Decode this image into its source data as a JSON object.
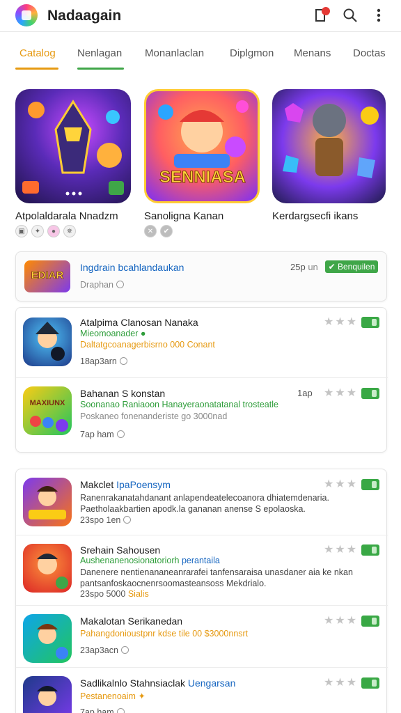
{
  "app": {
    "title": "Nadaagain",
    "brand_color": "#e69a12"
  },
  "topbar": {
    "icons": [
      "notifications-icon",
      "search-icon",
      "more-vert-icon"
    ]
  },
  "tabs": [
    {
      "label": "Catalog",
      "active": true
    },
    {
      "label": "Nenlagan",
      "active": false
    },
    {
      "label": "Monanlaclan",
      "active": false
    },
    {
      "label": "Diplgmon",
      "active": false
    },
    {
      "label": "Menans",
      "active": false
    },
    {
      "label": "Doctas",
      "active": false
    }
  ],
  "featured": [
    {
      "title": "Atpolaldarala Nnadzm",
      "badges": [
        "▣",
        "✦",
        "●",
        "✵"
      ]
    },
    {
      "title": "Sanoligna Kanan",
      "art_text": "SENNIASA",
      "badges": [
        "✕",
        "✔"
      ]
    },
    {
      "title": "Kerdargsecfi ikans",
      "badges": []
    }
  ],
  "promo": {
    "art_text": "EDIAR",
    "title": "Ingdrain bcahlandaukan",
    "subtitle": "Draphan",
    "size": "25p",
    "size_unit": "un",
    "button": "Benquilen"
  },
  "list1": [
    {
      "title": "Atalpima Clanosan Nanaka",
      "green": "Mieomoanader",
      "orange": "Daltatgcoanagerbisrno 000 Conant",
      "meta": "18ap3arn"
    },
    {
      "title": "Bahanan S konstan",
      "size": "1ap",
      "green": "Soonanao Raniaoon Hanayeraonatatanal trosteatle",
      "grey": "Poskaneo fonenanderiste go 3000nad",
      "meta": "7ap ham",
      "art_text": "MAXIUNX"
    }
  ],
  "list2": [
    {
      "title": "Makclet",
      "title_accent": "IpaPoensym",
      "desc": [
        "Ranenrakanatahdanant anlapendeatelecoanora dhiatemdenaria.",
        "Paetholaakbartien apodk.la gananan anense S epolaoska."
      ],
      "meta": "23spo 1en"
    },
    {
      "title": "Srehain Sahousen",
      "green": "Aushenanenosionatoriorh",
      "green_accent": "perantaila",
      "desc": [
        "Danenere nentienananeanrarafei tanfensaraisa unasdaner aia ke nkan",
        "pantsanfoskaocnenrsoomasteansoss Mekdrialo."
      ],
      "meta": "23spo 5000",
      "meta_highlight": "Sialis"
    },
    {
      "title": "Makalotan Serikanedan",
      "orange": "Pahangdonioustpnr kdse tile 00 $3000nnsrt",
      "meta": "23ap3acn"
    },
    {
      "title": "Sadlikalnlo Stahnsiaclak",
      "title_accent": "Uengarsan",
      "orange": "Pestanenoaim",
      "meta": "7ap ham"
    }
  ],
  "colors": {
    "green": "#3fa648",
    "blue": "#1565c0",
    "orange": "#e69a12"
  }
}
